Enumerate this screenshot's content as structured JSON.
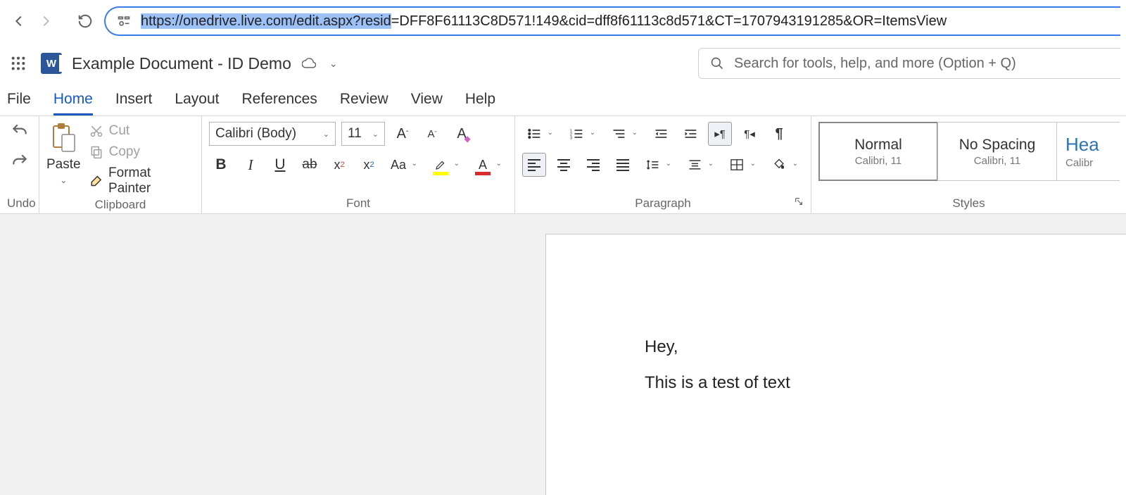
{
  "browser": {
    "url_selected": "https://onedrive.live.com/edit.aspx?resid",
    "url_rest": "=DFF8F61113C8D571!149&cid=dff8f61113c8d571&CT=1707943191285&OR=ItemsView"
  },
  "header": {
    "doc_title": "Example Document - ID Demo",
    "search_placeholder": "Search for tools, help, and more (Option + Q)"
  },
  "menu": {
    "items": [
      "File",
      "Home",
      "Insert",
      "Layout",
      "References",
      "Review",
      "View",
      "Help"
    ],
    "active": "Home"
  },
  "ribbon": {
    "undo_label": "Undo",
    "clipboard": {
      "label": "Clipboard",
      "paste": "Paste",
      "cut": "Cut",
      "copy": "Copy",
      "format_painter": "Format Painter"
    },
    "font": {
      "label": "Font",
      "name": "Calibri (Body)",
      "size": "11"
    },
    "paragraph": {
      "label": "Paragraph"
    },
    "styles": {
      "label": "Styles",
      "items": [
        {
          "name": "Normal",
          "desc": "Calibri, 11"
        },
        {
          "name": "No Spacing",
          "desc": "Calibri, 11"
        },
        {
          "name": "Hea",
          "desc": "Calibr"
        }
      ]
    }
  },
  "document": {
    "lines": [
      "Hey,",
      "This is a test of text"
    ]
  }
}
